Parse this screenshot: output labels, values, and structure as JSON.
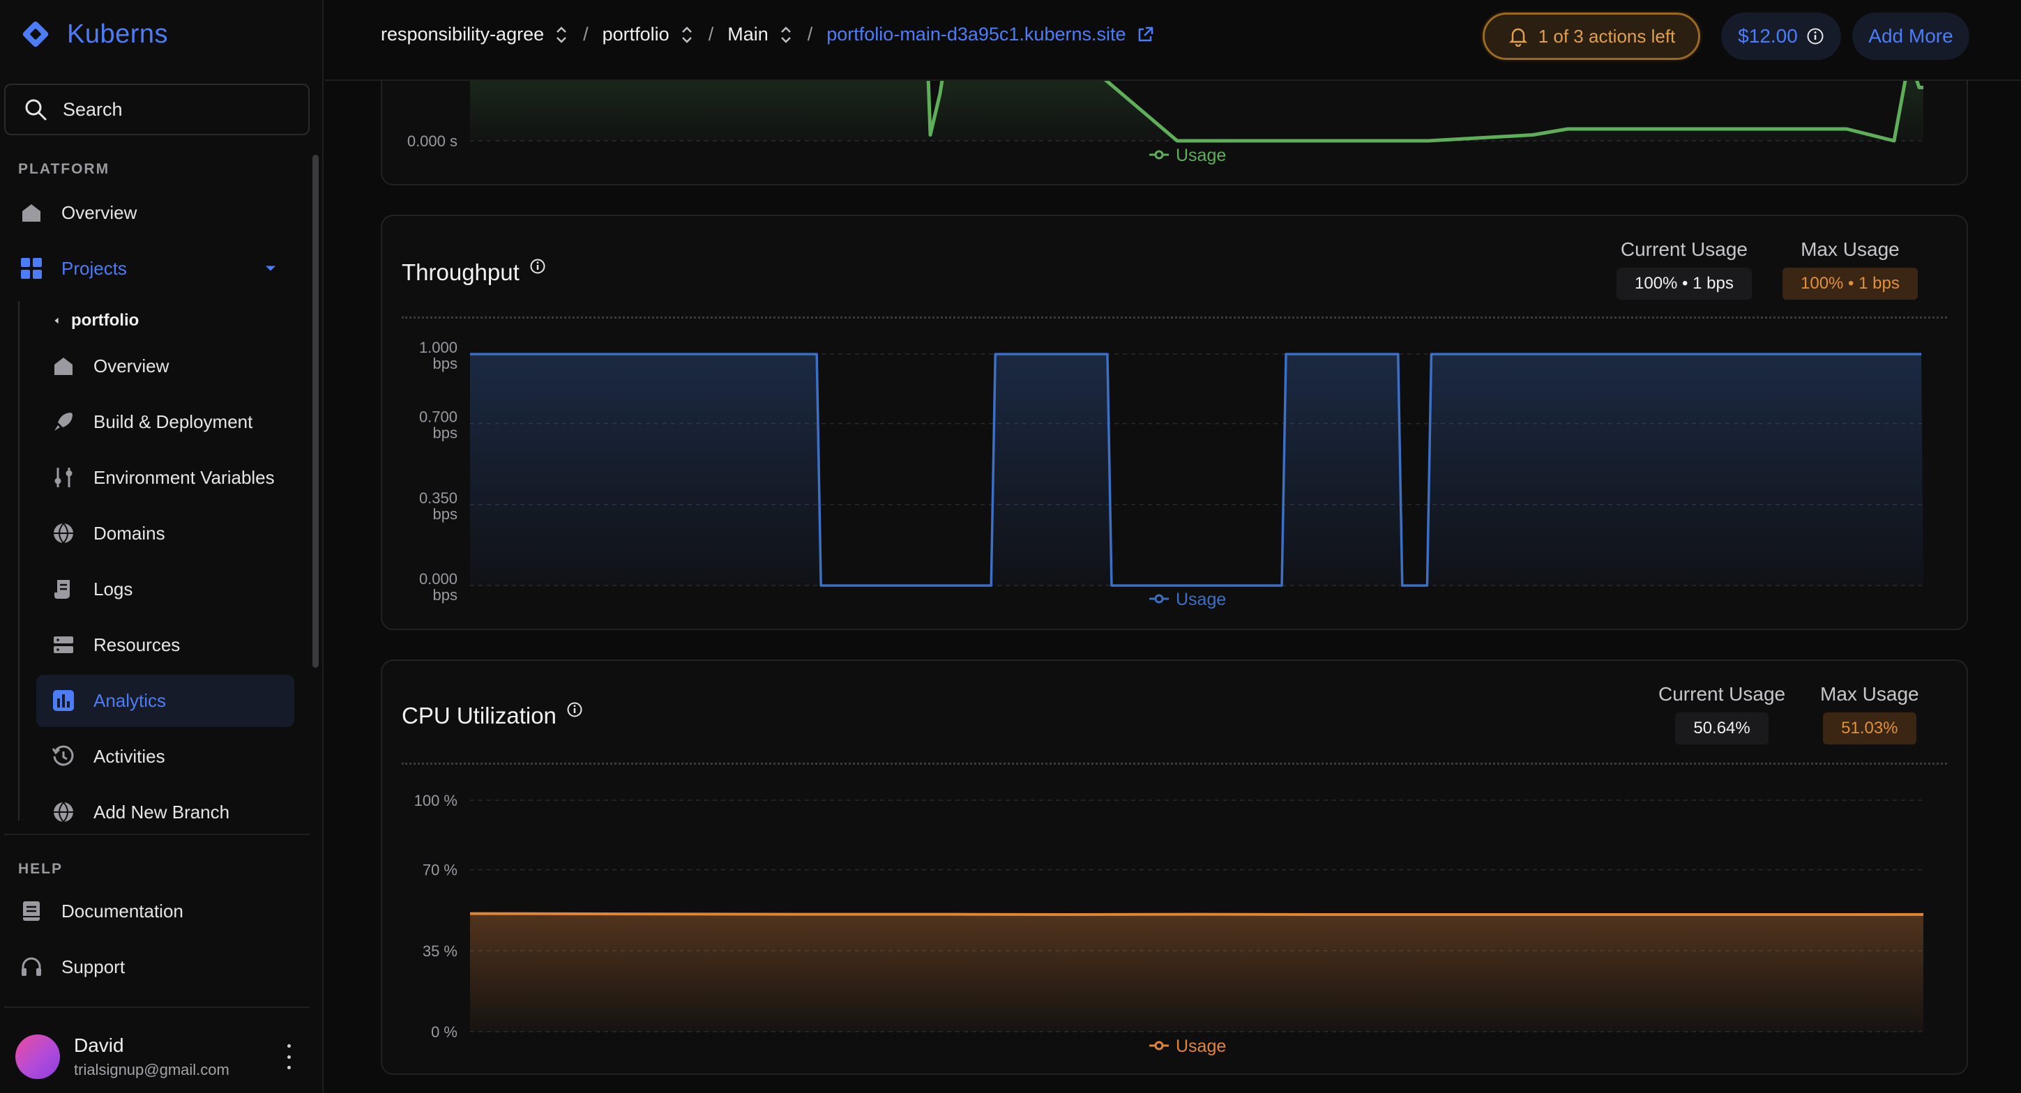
{
  "brand": {
    "name": "Kuberns"
  },
  "sidebar": {
    "search_label": "Search",
    "platform_label": "PLATFORM",
    "overview": "Overview",
    "projects": "Projects",
    "project_name": "portfolio",
    "sub_items": [
      {
        "label": "Overview",
        "icon": "home-icon"
      },
      {
        "label": "Build & Deployment",
        "icon": "rocket-icon"
      },
      {
        "label": "Environment Variables",
        "icon": "sliders-icon"
      },
      {
        "label": "Domains",
        "icon": "globe-icon"
      },
      {
        "label": "Logs",
        "icon": "logs-icon"
      },
      {
        "label": "Resources",
        "icon": "server-icon"
      },
      {
        "label": "Analytics",
        "icon": "analytics-icon"
      },
      {
        "label": "Activities",
        "icon": "history-icon"
      },
      {
        "label": "Add New Branch",
        "icon": "globe-icon"
      }
    ],
    "help_label": "HELP",
    "documentation": "Documentation",
    "support": "Support",
    "user": {
      "name": "David",
      "email": "trialsignup@gmail.com"
    }
  },
  "header": {
    "breadcrumb": [
      "responsibility-agree",
      "portfolio",
      "Main"
    ],
    "site_link": "portfolio-main-d3a95c1.kuberns.site",
    "actions_left": "1 of 3 actions left",
    "credit": "$12.00",
    "add_more": "Add More"
  },
  "colors": {
    "accent": "#4d7cf7",
    "response_line": "#5fae5a",
    "throughput_line": "#3d6fc4",
    "cpu_line": "#e0863a",
    "warning": "#e0a050"
  },
  "cards": {
    "response": {
      "y_tick": "0.000 s",
      "legend": "Usage"
    },
    "throughput": {
      "title": "Throughput",
      "current_label": "Current Usage",
      "current_value": "100% • 1 bps",
      "max_label": "Max Usage",
      "max_value": "100% • 1 bps",
      "legend": "Usage"
    },
    "cpu": {
      "title": "CPU Utilization",
      "current_label": "Current Usage",
      "current_value": "50.64%",
      "max_label": "Max Usage",
      "max_value": "51.03%",
      "legend": "Usage"
    }
  },
  "chart_data": [
    {
      "type": "area",
      "name": "response-time",
      "y_ticks": [
        "0.000 s"
      ],
      "series": [
        {
          "name": "Usage",
          "values": [
            0.7,
            0.7,
            0.7,
            0.05,
            0.4,
            0.7,
            0.7,
            0.7,
            0.0,
            0.0,
            0.0,
            0.0,
            0.05,
            0.1,
            0.1,
            0.1,
            0.0,
            0.7,
            0.45,
            0.45
          ]
        }
      ]
    },
    {
      "type": "area",
      "name": "throughput",
      "ylim": [
        0,
        1
      ],
      "y_ticks": [
        {
          "value": 1.0,
          "label": [
            "1.000",
            "bps"
          ]
        },
        {
          "value": 0.7,
          "label": [
            "0.700",
            "bps"
          ]
        },
        {
          "value": 0.35,
          "label": [
            "0.350",
            "bps"
          ]
        },
        {
          "value": 0.0,
          "label": [
            "0.000",
            "bps"
          ]
        }
      ],
      "series": [
        {
          "name": "Usage",
          "values": [
            1,
            1,
            1,
            1,
            1,
            1,
            1,
            1,
            1,
            1,
            1,
            1,
            0,
            0,
            0,
            0,
            0,
            0,
            1,
            1,
            1,
            1,
            0,
            0,
            0,
            0,
            0,
            0,
            1,
            1,
            1,
            1,
            0,
            1,
            1,
            1,
            1,
            1,
            1,
            1,
            1,
            1,
            1,
            1,
            1,
            1,
            1,
            1,
            1,
            1
          ]
        }
      ]
    },
    {
      "type": "area",
      "name": "cpu-utilization",
      "ylim": [
        0,
        100
      ],
      "y_ticks": [
        {
          "value": 100,
          "label": [
            "100 %"
          ]
        },
        {
          "value": 70,
          "label": [
            "70 %"
          ]
        },
        {
          "value": 35,
          "label": [
            "35 %"
          ]
        },
        {
          "value": 0,
          "label": [
            "0 %"
          ]
        }
      ],
      "series": [
        {
          "name": "Usage",
          "values": [
            51.03,
            50.9,
            50.8,
            50.7,
            50.7,
            50.6,
            50.7,
            50.6,
            50.6,
            50.6,
            50.6,
            50.6,
            50.64
          ]
        }
      ]
    }
  ]
}
